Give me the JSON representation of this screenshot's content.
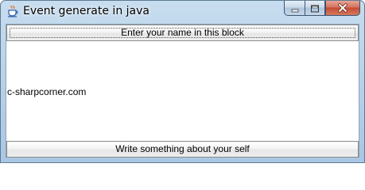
{
  "window": {
    "title": "Event generate in java"
  },
  "buttons": {
    "north_label": "Enter your name in this block",
    "south_label": "Write something about your self"
  },
  "center": {
    "text": "c-sharpcorner.com"
  },
  "icons": {
    "app": "java-cup-icon",
    "minimize": "minimize-icon",
    "maximize": "maximize-icon",
    "close": "close-icon"
  },
  "colors": {
    "close_button": "#c44b32",
    "title_bar": "#b7d1e8"
  }
}
